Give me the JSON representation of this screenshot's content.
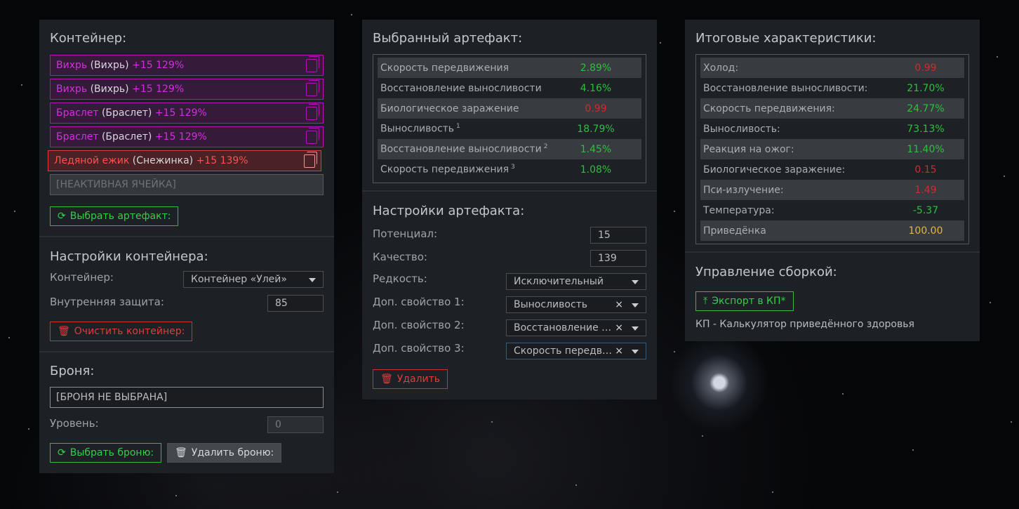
{
  "container_panel": {
    "title": "Контейнер:",
    "slots": [
      {
        "name": "Вихрь",
        "type": "(Вихрь)",
        "level": "+15 129%",
        "state": "active"
      },
      {
        "name": "Вихрь",
        "type": "(Вихрь)",
        "level": "+15 129%",
        "state": "active"
      },
      {
        "name": "Браслет",
        "type": "(Браслет)",
        "level": "+15 129%",
        "state": "active"
      },
      {
        "name": "Браслет",
        "type": "(Браслет)",
        "level": "+15 129%",
        "state": "active"
      },
      {
        "name": "Ледяной ежик",
        "type": "(Снежинка)",
        "level": "+15 139%",
        "state": "selected"
      }
    ],
    "inactive_slot": "[НЕАКТИВНАЯ ЯЧЕЙКА]",
    "choose_artifact_button": "Выбрать артефакт:"
  },
  "container_settings": {
    "title": "Настройки контейнера:",
    "container_label": "Контейнер:",
    "container_value": "Контейнер «Улей»",
    "inner_protection_label": "Внутренняя защита:",
    "inner_protection_value": "85",
    "clear_button": "Очистить контейнер:"
  },
  "armor": {
    "title": "Броня:",
    "armor_value": "[БРОНЯ НЕ ВЫБРАНА]",
    "level_label": "Уровень:",
    "level_value": "0",
    "choose_button": "Выбрать броню:",
    "delete_button": "Удалить броню:"
  },
  "selected_artifact": {
    "title": "Выбранный артефакт:",
    "stats": [
      {
        "label": "Скорость передвижения",
        "sup": "",
        "value": "2.89%",
        "color": "green"
      },
      {
        "label": "Восстановление выносливости",
        "sup": "",
        "value": "4.16%",
        "color": "green"
      },
      {
        "label": "Биологическое заражение",
        "sup": "",
        "value": "0.99",
        "color": "red"
      },
      {
        "label": "Выносливость",
        "sup": "1",
        "value": "18.79%",
        "color": "green"
      },
      {
        "label": "Восстановление выносливости",
        "sup": "2",
        "value": "1.45%",
        "color": "green"
      },
      {
        "label": "Скорость передвижения",
        "sup": "3",
        "value": "1.08%",
        "color": "green"
      }
    ]
  },
  "artifact_settings": {
    "title": "Настройки артефакта:",
    "potential_label": "Потенциал:",
    "potential_value": "15",
    "quality_label": "Качество:",
    "quality_value": "139",
    "rarity_label": "Редкость:",
    "rarity_value": "Исключительный",
    "extra1_label": "Доп. свойство 1:",
    "extra1_value": "Выносливость",
    "extra2_label": "Доп. свойство 2:",
    "extra2_value": "Восстановление выносливости",
    "extra3_label": "Доп. свойство 3:",
    "extra3_value": "Скорость передвижения",
    "clear_symbol": "×",
    "delete_button": "Удалить"
  },
  "total_stats": {
    "title": "Итоговые характеристики:",
    "stats": [
      {
        "label": "Холод:",
        "value": "0.99",
        "color": "red"
      },
      {
        "label": "Восстановление выносливости:",
        "value": "21.70%",
        "color": "green"
      },
      {
        "label": "Скорость передвижения:",
        "value": "24.77%",
        "color": "green"
      },
      {
        "label": "Выносливость:",
        "value": "73.13%",
        "color": "green"
      },
      {
        "label": "Реакция на ожог:",
        "value": "11.40%",
        "color": "green"
      },
      {
        "label": "Биологическое заражение:",
        "value": "0.15",
        "color": "red"
      },
      {
        "label": "Пси-излучение:",
        "value": "1.49",
        "color": "red"
      },
      {
        "label": "Температура:",
        "value": "-5.37",
        "color": "green"
      },
      {
        "label": "Приведёнка",
        "value": "100.00",
        "color": "yellow"
      }
    ]
  },
  "build_management": {
    "title": "Управление сборкой:",
    "export_button": "Экспорт в КП*",
    "note": "КП - Калькулятор приведённого здоровья"
  }
}
